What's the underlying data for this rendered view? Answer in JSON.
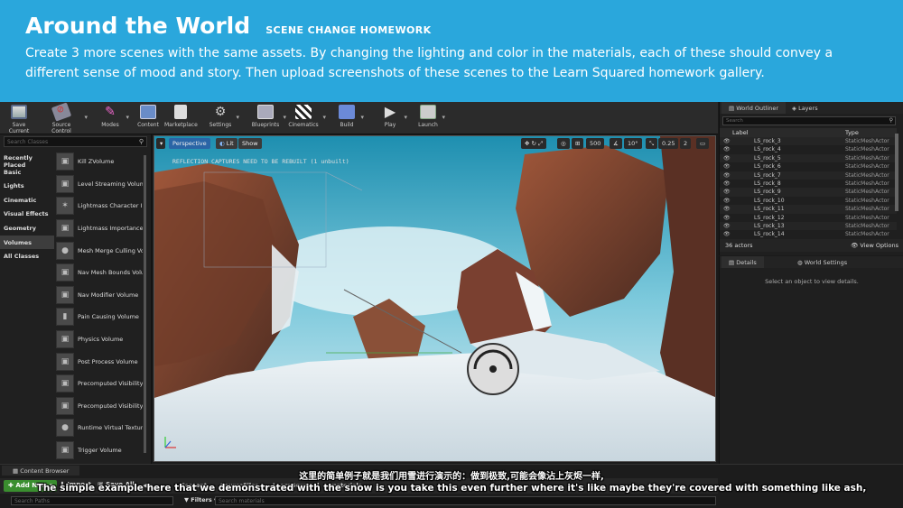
{
  "banner": {
    "title": "Around the World",
    "subtitle": "SCENE CHANGE HOMEWORK",
    "description": "Create 3 more scenes with the same assets. By changing the lighting and color in the materials, each of these should convey a different sense of mood and story. Then upload screenshots of these scenes to the Learn Squared homework gallery."
  },
  "toolbar": {
    "buttons": [
      {
        "label": "Save Current",
        "icon": "save-icon"
      },
      {
        "label": "Source Control",
        "icon": "source-control-icon"
      },
      {
        "label": "Modes",
        "icon": "modes-icon"
      },
      {
        "label": "Content",
        "icon": "content-icon"
      },
      {
        "label": "Marketplace",
        "icon": "marketplace-icon"
      },
      {
        "label": "Settings",
        "icon": "gear-icon"
      },
      {
        "label": "Blueprints",
        "icon": "blueprints-icon"
      },
      {
        "label": "Cinematics",
        "icon": "clapper-icon"
      },
      {
        "label": "Build",
        "icon": "build-icon"
      },
      {
        "label": "Play",
        "icon": "play-icon"
      },
      {
        "label": "Launch",
        "icon": "launch-icon"
      }
    ]
  },
  "modes": {
    "search_placeholder": "Search Classes",
    "categories": [
      "Recently Placed",
      "Basic",
      "Lights",
      "Cinematic",
      "Visual Effects",
      "Geometry",
      "Volumes",
      "All Classes"
    ],
    "selected_category": "Volumes",
    "items": [
      "Kill ZVolume",
      "Level Streaming Volum",
      "Lightmass Character In",
      "Lightmass Importance",
      "Mesh Merge Culling Vo",
      "Nav Mesh Bounds Volu",
      "Nav Modifier Volume",
      "Pain Causing Volume",
      "Physics Volume",
      "Post Process Volume",
      "Precomputed Visibility",
      "Precomputed Visibility",
      "Runtime Virtual Textur",
      "Trigger Volume"
    ]
  },
  "viewport": {
    "perspective": "Perspective",
    "lit": "Lit",
    "show": "Show",
    "warning": "REFLECTION CAPTURES NEED TO BE REBUILT (1 unbuilt)",
    "grid_value": "500",
    "rotation_value": "10°",
    "scale_value": "0.25",
    "camera_speed": "2",
    "colors": {
      "sky": "#3fb3cf",
      "snow": "#e8eef2",
      "rock": "#8a4a34"
    }
  },
  "outliner": {
    "tab1": "World Outliner",
    "tab2": "Layers",
    "search_placeholder": "Search",
    "col_label": "Label",
    "col_type": "Type",
    "rows": [
      {
        "label": "LS_rock_3",
        "type": "StaticMeshActor"
      },
      {
        "label": "LS_rock_4",
        "type": "StaticMeshActor"
      },
      {
        "label": "LS_rock_5",
        "type": "StaticMeshActor"
      },
      {
        "label": "LS_rock_6",
        "type": "StaticMeshActor"
      },
      {
        "label": "LS_rock_7",
        "type": "StaticMeshActor"
      },
      {
        "label": "LS_rock_8",
        "type": "StaticMeshActor"
      },
      {
        "label": "LS_rock_9",
        "type": "StaticMeshActor"
      },
      {
        "label": "LS_rock_10",
        "type": "StaticMeshActor"
      },
      {
        "label": "LS_rock_11",
        "type": "StaticMeshActor"
      },
      {
        "label": "LS_rock_12",
        "type": "StaticMeshActor"
      },
      {
        "label": "LS_rock_13",
        "type": "StaticMeshActor"
      },
      {
        "label": "LS_rock_14",
        "type": "StaticMeshActor"
      }
    ],
    "actor_count": "36 actors",
    "view_options": "View Options"
  },
  "details": {
    "tab1": "Details",
    "tab2": "World Settings",
    "message": "Select an object to view details."
  },
  "content_browser": {
    "tab": "Content Browser",
    "add_new": "Add New",
    "import": "Import",
    "save_all": "Save All",
    "path": [
      "Content",
      "SourceFiles",
      "LearnSquared",
      "materials"
    ],
    "search_paths_placeholder": "Search Paths",
    "filters": "Filters",
    "search_placeholder": "Search materials"
  },
  "subtitles": {
    "zh": "这里的简单例子就是我们用雪进行演示的：做到极致,可能会像沾上灰烬一样,",
    "en": "The simple example here that we demonstrated with the snow is you take this even further where it's like maybe they're covered with something like ash,"
  }
}
